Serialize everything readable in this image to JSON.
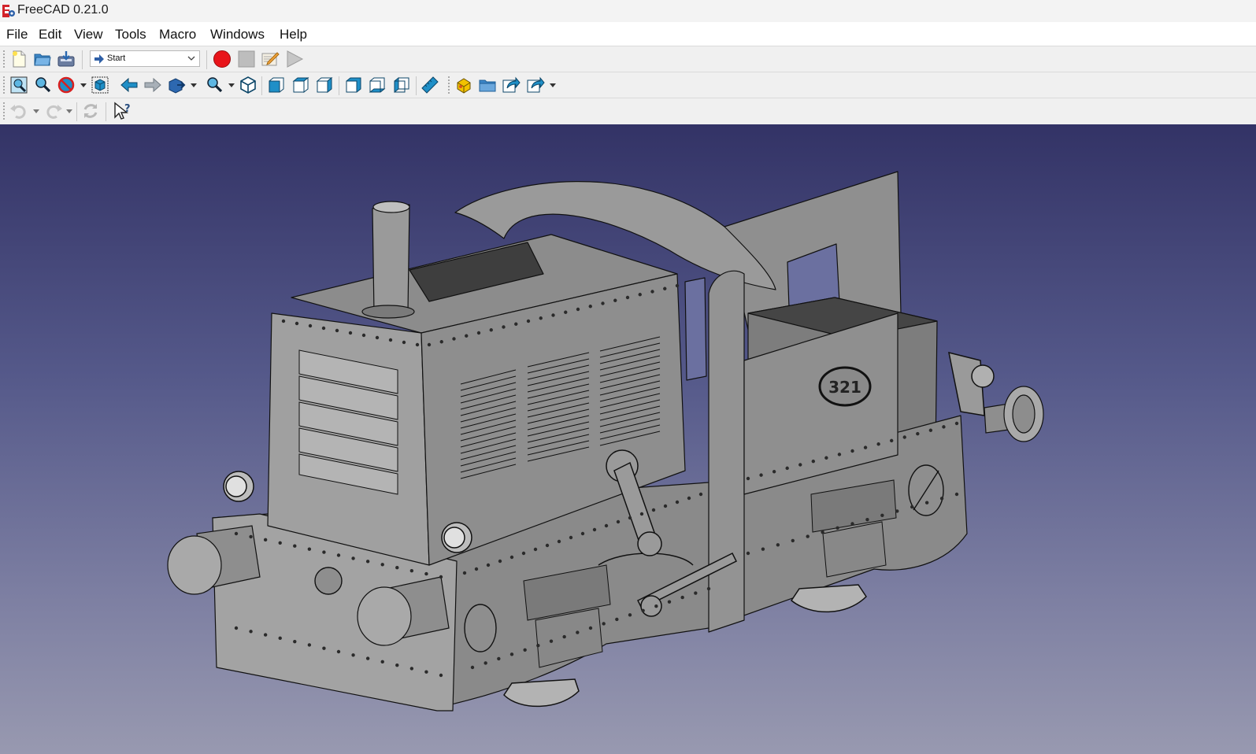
{
  "window": {
    "title": "FreeCAD 0.21.0",
    "app_icon": "freecad-logo-icon"
  },
  "menubar": {
    "items": [
      {
        "label": "File"
      },
      {
        "label": "Edit"
      },
      {
        "label": "View"
      },
      {
        "label": "Tools"
      },
      {
        "label": "Macro"
      },
      {
        "label": "Windows"
      },
      {
        "label": "Help"
      }
    ]
  },
  "toolbar_file": {
    "icons": [
      "new-document-icon",
      "open-folder-icon",
      "save-icon"
    ],
    "workbench": {
      "selected": "Start",
      "icon": "start-arrow-icon"
    },
    "macro_icons": [
      "record-macro-icon",
      "stop-macro-icon",
      "edit-macro-icon",
      "run-macro-icon"
    ]
  },
  "toolbar_view": {
    "icons": [
      "fit-all-icon",
      "fit-selection-icon",
      "draw-style-icon",
      "bounding-box-icon",
      "back-arrow-icon",
      "forward-arrow-icon",
      "sync-view-icon",
      "zoom-icon",
      "isometric-icon",
      "front-view-icon",
      "top-view-icon",
      "right-view-icon",
      "rear-view-icon",
      "bottom-view-icon",
      "left-view-icon",
      "measure-icon",
      "part-icon",
      "group-folder-icon",
      "link-icon",
      "link-actions-icon"
    ]
  },
  "toolbar_edit": {
    "icons": [
      "undo-icon",
      "redo-icon",
      "refresh-icon",
      "whats-this-icon"
    ]
  },
  "viewport": {
    "background_top": "#333366",
    "background_bottom": "#9899b0",
    "model_color": "#8c8c8c",
    "model_number": "321"
  },
  "colors": {
    "record": "#e8141a",
    "accent_blue": "#1f8fc7",
    "toolbar_bg": "#f0f0f0"
  }
}
